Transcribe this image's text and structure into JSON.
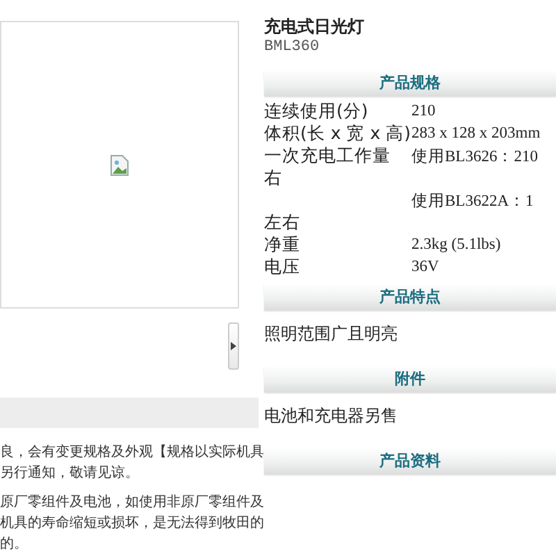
{
  "gallery": {
    "main_image": {
      "kind": "broken-image"
    }
  },
  "notes": [
    {
      "lines": [
        "良，会有变更规格及外观【规格以实际机具",
        "另行通知，敬请见谅。"
      ]
    },
    {
      "lines": [
        "原厂零组件及电池，如使用非原厂零组件及",
        "机具的寿命缩短或损坏，是无法得到牧田的",
        "的。"
      ]
    }
  ],
  "product": {
    "title": "充电式日光灯",
    "model": "BML360"
  },
  "sections": [
    {
      "heading": "产品规格",
      "kind": "specs",
      "rows": [
        {
          "label": "连续使用(分)",
          "value": "210"
        },
        {
          "label": "体积(长 x 宽 x 高)",
          "value": "283 x 128 x 203mm"
        },
        {
          "label": "一次充电工作量",
          "value": "使用BL3626：210"
        },
        {
          "label": "右"
        },
        {
          "value": "使用BL3622A：1"
        },
        {
          "label": "左右"
        },
        {
          "label": "净重",
          "value": "2.3kg (5.1lbs)"
        },
        {
          "label": "电压",
          "value": "36V"
        }
      ]
    },
    {
      "heading": "产品特点",
      "kind": "text",
      "text": "照明范围广且明亮"
    },
    {
      "heading": "附件",
      "kind": "text",
      "text": "电池和充电器另售"
    },
    {
      "heading": "产品资料",
      "kind": "empty"
    }
  ]
}
